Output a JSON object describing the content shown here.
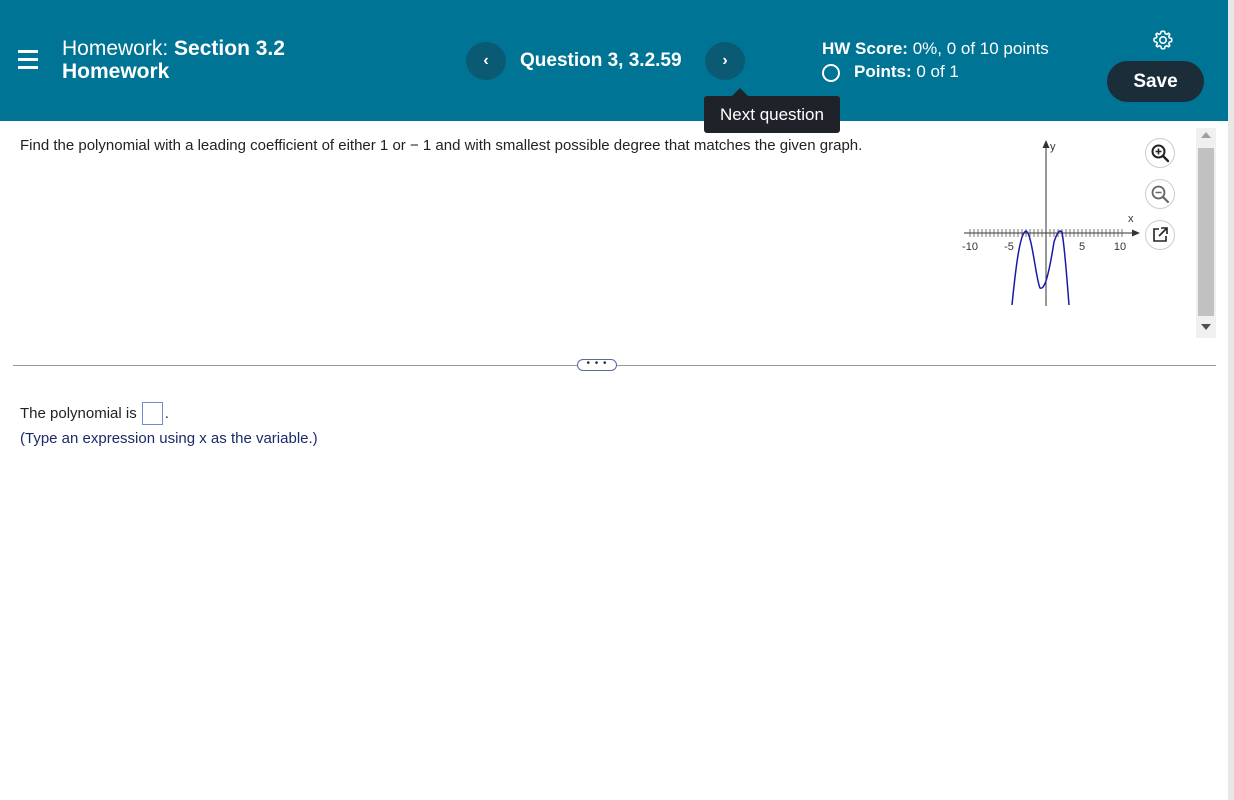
{
  "header": {
    "title_prefix": "Homework:",
    "title_bold": "Section 3.2",
    "title_line2": "Homework",
    "question_label": "Question 3, 3.2.59",
    "prev_symbol": "‹",
    "next_symbol": "›",
    "tooltip": "Next question",
    "score_label": "HW Score:",
    "score_value": "0%, 0 of 10 points",
    "points_label": "Points:",
    "points_value": "0 of 1",
    "save_label": "Save",
    "colors": {
      "bar": "#007494",
      "nav_button": "#0a5a73",
      "save_button": "#1c2d3a"
    }
  },
  "question": {
    "text": "Find the polynomial with a leading coefficient of either 1 or − 1 and with smallest possible degree that matches the given graph."
  },
  "graph": {
    "x_label": "x",
    "y_label": "y",
    "tick_labels": [
      "-10",
      "-5",
      "5",
      "10"
    ],
    "curve_color": "#1a1aa8"
  },
  "more_handle": "• • •",
  "answer": {
    "prompt": "The polynomial is",
    "value": "",
    "hint": "(Type an expression using x as the variable.)"
  }
}
